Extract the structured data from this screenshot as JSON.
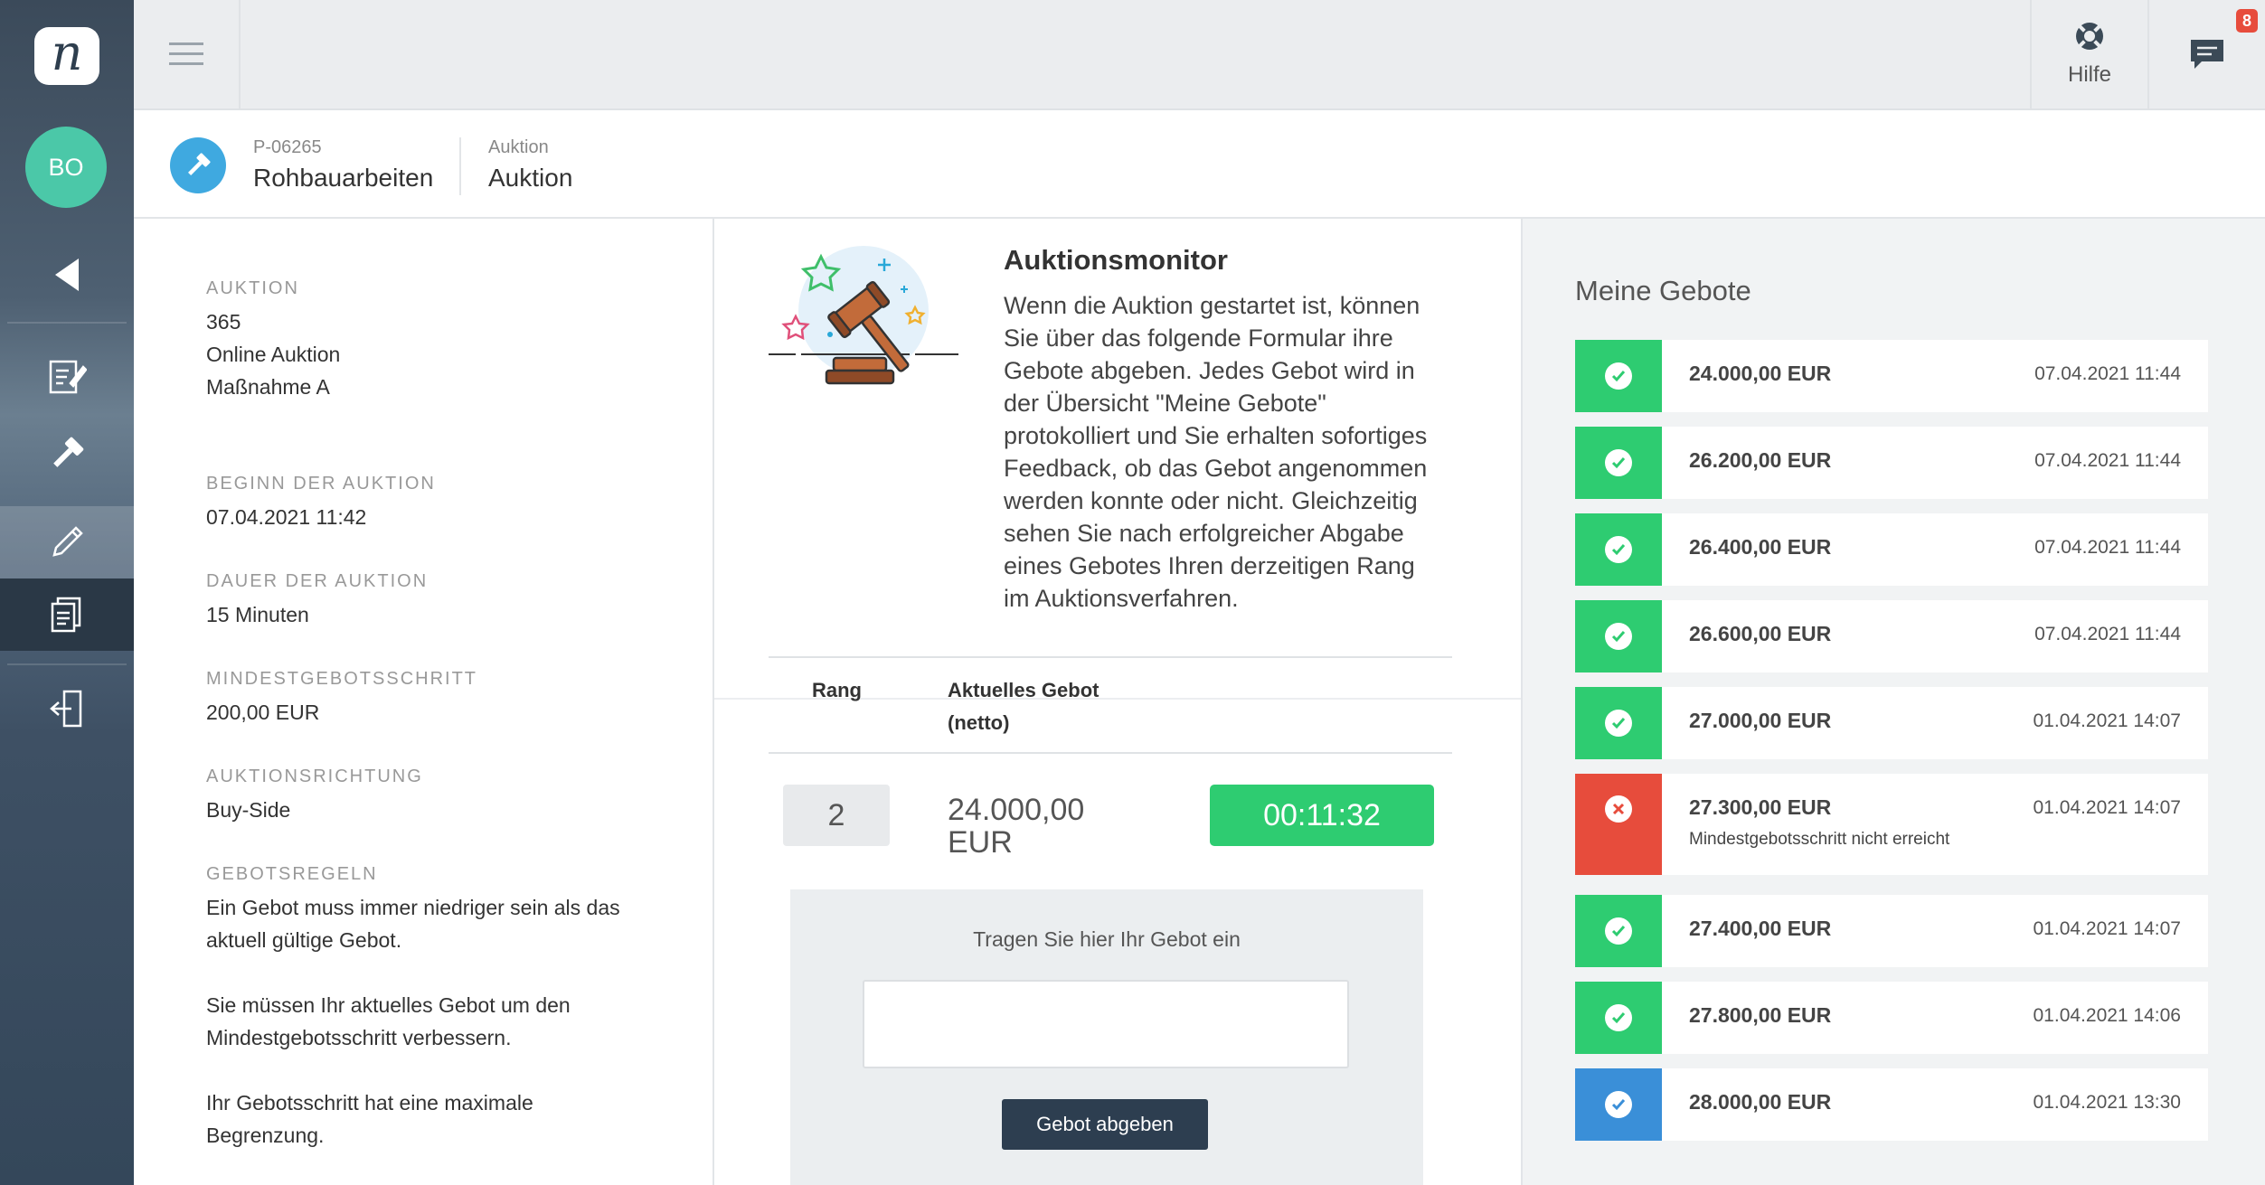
{
  "sidebar": {
    "logo_letter": "n",
    "avatar_initials": "BO"
  },
  "topbar": {
    "help_label": "Hilfe",
    "chat_badge": "8"
  },
  "header": {
    "project_id": "P-06265",
    "project_name": "Rohbauarbeiten",
    "section_small": "Auktion",
    "section_large": "Auktion"
  },
  "details": {
    "auction_label": "AUKTION",
    "auction_id": "365",
    "auction_name": "Online Auktion",
    "auction_measure": "Maßnahme A",
    "start_label": "BEGINN DER AUKTION",
    "start_value": "07.04.2021 11:42",
    "duration_label": "DAUER DER AUKTION",
    "duration_value": "15 Minuten",
    "min_step_label": "MINDESTGEBOTSSCHRITT",
    "min_step_value": "200,00 EUR",
    "direction_label": "AUKTIONSRICHTUNG",
    "direction_value": "Buy-Side",
    "rules_label": "GEBOTSREGELN",
    "rule_1a": "Ein Gebot muss immer niedriger sein als das",
    "rule_1b": "aktuell gültige Gebot.",
    "rule_2a": "Sie müssen Ihr aktuelles Gebot um den",
    "rule_2b": "Mindestgebotsschritt verbessern.",
    "rule_3a": "Ihr Gebotsschritt hat eine maximale",
    "rule_3b": "Begrenzung."
  },
  "monitor": {
    "title": "Auktionsmonitor",
    "intro_lines": [
      "Wenn die Auktion gestartet ist, können",
      "Sie über das folgende Formular ihre",
      "Gebote abgeben. Jedes Gebot wird in",
      "der Übersicht \"Meine Gebote\"",
      "protokolliert und Sie erhalten sofortiges",
      "Feedback, ob das Gebot angenommen",
      "werden konnte oder nicht. Gleichzeitig",
      "sehen Sie nach erfolgreicher Abgabe",
      "eines Gebotes Ihren derzeitigen Rang",
      "im Auktionsverfahren."
    ],
    "col_rank": "Rang",
    "col_bid_1": "Aktuelles Gebot",
    "col_bid_2": "(netto)",
    "rank": "2",
    "current_bid_1": "24.000,00",
    "current_bid_2": "EUR",
    "timer": "00:11:32",
    "input_label": "Tragen Sie hier Ihr Gebot ein",
    "input_value": "",
    "submit_label": "Gebot abgeben"
  },
  "my_bids": {
    "title": "Meine Gebote",
    "items": [
      {
        "amount": "24.000,00 EUR",
        "date": "07.04.2021 11:44",
        "status": "accepted",
        "color": "#2ecc71",
        "note": ""
      },
      {
        "amount": "26.200,00 EUR",
        "date": "07.04.2021 11:44",
        "status": "accepted",
        "color": "#2ecc71",
        "note": ""
      },
      {
        "amount": "26.400,00 EUR",
        "date": "07.04.2021 11:44",
        "status": "accepted",
        "color": "#2ecc71",
        "note": ""
      },
      {
        "amount": "26.600,00 EUR",
        "date": "07.04.2021 11:44",
        "status": "accepted",
        "color": "#2ecc71",
        "note": ""
      },
      {
        "amount": "27.000,00 EUR",
        "date": "01.04.2021 14:07",
        "status": "accepted",
        "color": "#2ecc71",
        "note": ""
      },
      {
        "amount": "27.300,00 EUR",
        "date": "01.04.2021 14:07",
        "status": "rejected",
        "color": "#e74c3c",
        "note": "Mindestgebotsschritt nicht erreicht"
      },
      {
        "amount": "27.400,00 EUR",
        "date": "01.04.2021 14:07",
        "status": "accepted",
        "color": "#2ecc71",
        "note": ""
      },
      {
        "amount": "27.800,00 EUR",
        "date": "01.04.2021 14:06",
        "status": "accepted",
        "color": "#2ecc71",
        "note": ""
      },
      {
        "amount": "28.000,00 EUR",
        "date": "01.04.2021 13:30",
        "status": "initial",
        "color": "#3a8fd8",
        "note": ""
      }
    ]
  },
  "icons": {
    "menu": "hamburger-icon",
    "help": "lifebuoy-icon",
    "chat": "chat-icon",
    "back": "back-arrow-icon",
    "edit_doc": "edit-document-icon",
    "auction": "gavel-icon",
    "pencil": "pencil-icon",
    "docs": "documents-icon",
    "logout": "logout-icon",
    "check": "check-icon",
    "cross": "cross-icon"
  }
}
